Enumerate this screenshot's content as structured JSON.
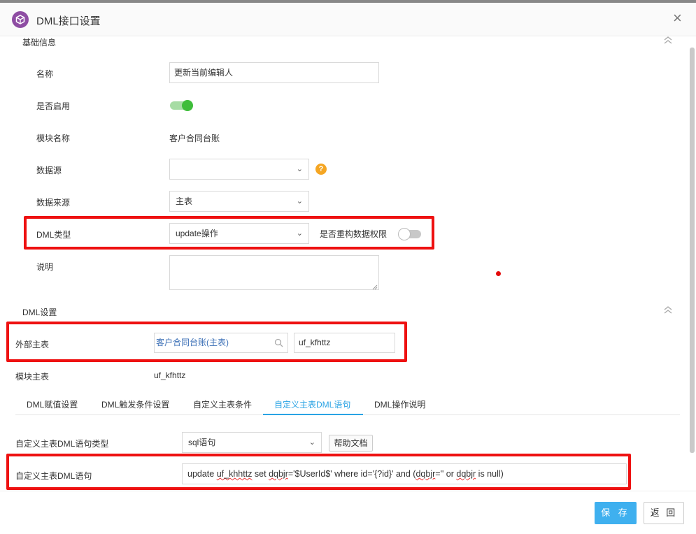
{
  "dialog": {
    "title": "DML接口设置",
    "close_symbol": "×"
  },
  "basic_section": {
    "title": "基础信息",
    "fields": {
      "name_label": "名称",
      "name_value": "更新当前编辑人",
      "enabled_label": "是否启用",
      "enabled_value": true,
      "module_label": "模块名称",
      "module_value": "客户合同台账",
      "datasource_label": "数据源",
      "datasource_value": "",
      "data_origin_label": "数据来源",
      "data_origin_value": "主表",
      "dml_type_label": "DML类型",
      "dml_type_value": "update操作",
      "rebuild_perm_label": "是否重构数据权限",
      "rebuild_perm_value": false,
      "desc_label": "说明",
      "desc_value": ""
    }
  },
  "dml_section": {
    "title": "DML设置",
    "external_main_label": "外部主表",
    "external_main_value": "客户合同台账(主表)",
    "external_table_value": "uf_kfhttz",
    "module_main_label": "模块主表",
    "module_main_value": "uf_kfhttz",
    "tabs": [
      {
        "label": "DML赋值设置",
        "active": false
      },
      {
        "label": "DML触发条件设置",
        "active": false
      },
      {
        "label": "自定义主表条件",
        "active": false
      },
      {
        "label": "自定义主表DML语句",
        "active": true
      },
      {
        "label": "DML操作说明",
        "active": false
      }
    ],
    "stmt_type_label": "自定义主表DML语句类型",
    "stmt_type_value": "sql语句",
    "help_doc_label": "帮助文档",
    "stmt_label": "自定义主表DML语句",
    "stmt_parts": [
      "update ",
      "uf_khhttz",
      " set ",
      "dqbjr",
      "='$UserId$' where id='{?id}' and (",
      "dqbjr",
      "='' or ",
      "dqbjr",
      " is null)"
    ]
  },
  "footer": {
    "save_label": "保 存",
    "back_label": "返 回"
  },
  "colors": {
    "accent": "#2aa3e4",
    "primary_button": "#3fb0ef",
    "highlight_box": "#ee1111",
    "toggle_on": "#3ebd3a",
    "logo": "#8e4da3"
  },
  "icons": [
    "app-logo-icon",
    "close-icon",
    "collapse-up-icon",
    "chevron-down-icon",
    "help-icon",
    "search-icon",
    "resize-grip-icon"
  ]
}
